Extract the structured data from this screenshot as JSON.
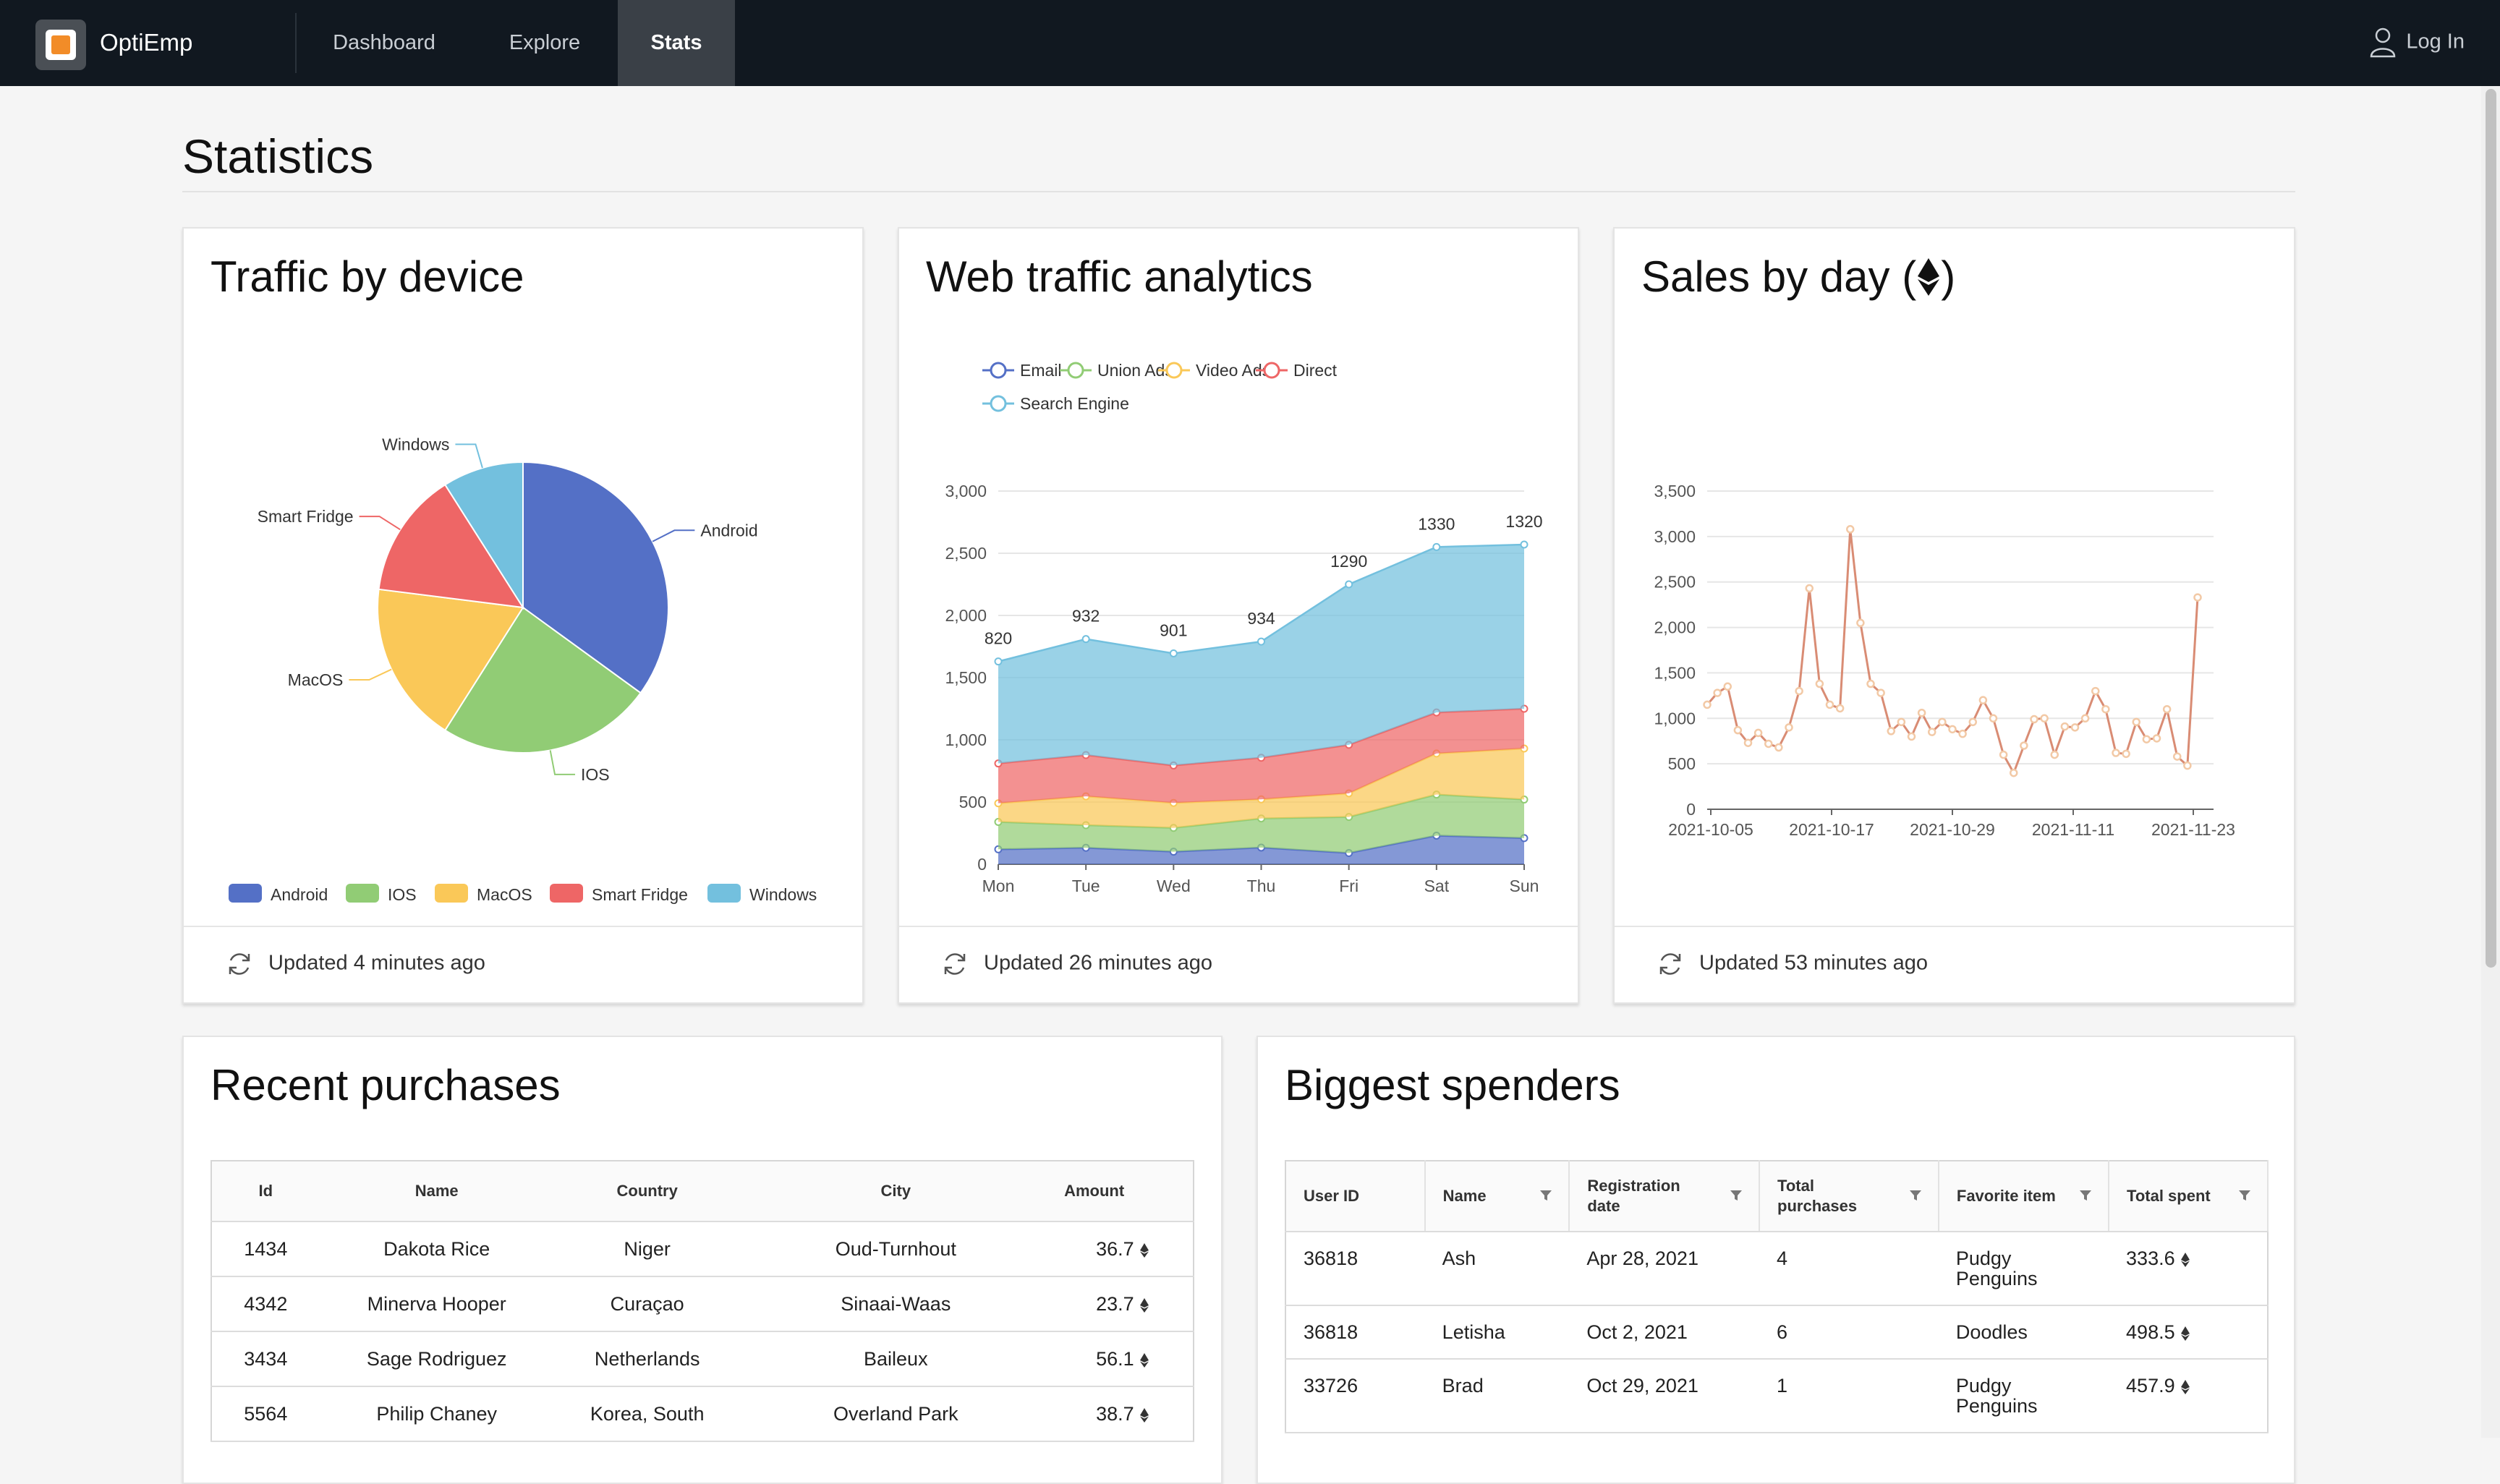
{
  "app": {
    "brand": "OptiEmp",
    "login": "Log In"
  },
  "nav": [
    {
      "label": "Dashboard",
      "active": false
    },
    {
      "label": "Explore",
      "active": false
    },
    {
      "label": "Stats",
      "active": true
    }
  ],
  "page": {
    "title": "Statistics"
  },
  "cards": {
    "traffic_device": {
      "title": "Traffic by device",
      "updated": "Updated 4 minutes ago"
    },
    "web_traffic": {
      "title": "Web traffic analytics",
      "updated": "Updated 26 minutes ago"
    },
    "sales_day": {
      "title": "Sales by day (",
      "title_end": ")",
      "updated": "Updated 53 minutes ago"
    }
  },
  "chart_data": [
    {
      "type": "pie",
      "title": "Traffic by device",
      "labels": [
        "Android",
        "IOS",
        "MacOS",
        "Smart Fridge",
        "Windows"
      ],
      "values": [
        35,
        24,
        18,
        14,
        9
      ],
      "colors": [
        "#5470c6",
        "#91cc75",
        "#fac858",
        "#ee6666",
        "#73c0de"
      ],
      "legend_position": "bottom"
    },
    {
      "type": "area",
      "stacked": true,
      "title": "Web traffic analytics",
      "categories": [
        "Mon",
        "Tue",
        "Wed",
        "Thu",
        "Fri",
        "Sat",
        "Sun"
      ],
      "ylim": [
        0,
        3000
      ],
      "yticks": [
        0,
        500,
        1000,
        1500,
        2000,
        2500,
        3000
      ],
      "series": [
        {
          "name": "Email",
          "color": "#5470c6",
          "values": [
            120,
            132,
            101,
            134,
            90,
            230,
            210
          ]
        },
        {
          "name": "Union Ads",
          "color": "#91cc75",
          "values": [
            220,
            182,
            191,
            234,
            290,
            330,
            310
          ]
        },
        {
          "name": "Video Ads",
          "color": "#fac858",
          "values": [
            150,
            232,
            201,
            154,
            190,
            330,
            410
          ]
        },
        {
          "name": "Direct",
          "color": "#ee6666",
          "values": [
            320,
            332,
            301,
            334,
            390,
            330,
            320
          ]
        },
        {
          "name": "Search Engine",
          "color": "#73c0de",
          "values": [
            820,
            932,
            901,
            934,
            1290,
            1330,
            1320
          ]
        }
      ],
      "top_labels": [
        "820",
        "932",
        "901",
        "934",
        "1290",
        "1330",
        "1320"
      ],
      "legend_position": "top"
    },
    {
      "type": "line",
      "title": "Sales by day",
      "x_tick_labels": [
        "2021-10-05",
        "2021-10-17",
        "2021-10-29",
        "2021-11-11",
        "2021-11-23"
      ],
      "ylim": [
        0,
        3500
      ],
      "yticks": [
        0,
        500,
        1000,
        1500,
        2000,
        2500,
        3000,
        3500
      ],
      "values": [
        1150,
        1280,
        1350,
        870,
        730,
        840,
        720,
        680,
        900,
        1300,
        2430,
        1380,
        1150,
        1110,
        3080,
        2050,
        1380,
        1280,
        860,
        960,
        800,
        1060,
        850,
        960,
        880,
        830,
        960,
        1200,
        1000,
        600,
        400,
        700,
        990,
        1000,
        600,
        910,
        900,
        1000,
        1300,
        1100,
        620,
        610,
        960,
        770,
        780,
        1100,
        580,
        480,
        2330
      ],
      "line_color": "#d98c74",
      "point_color": "#f2c9a6"
    }
  ],
  "recent_purchases": {
    "title": "Recent purchases",
    "columns": [
      "Id",
      "Name",
      "Country",
      "City",
      "Amount"
    ],
    "rows": [
      {
        "id": "1434",
        "name": "Dakota Rice",
        "country": "Niger",
        "city": "Oud-Turnhout",
        "amount": "36.7"
      },
      {
        "id": "4342",
        "name": "Minerva Hooper",
        "country": "Curaçao",
        "city": "Sinaai-Waas",
        "amount": "23.7"
      },
      {
        "id": "3434",
        "name": "Sage Rodriguez",
        "country": "Netherlands",
        "city": "Baileux",
        "amount": "56.1"
      },
      {
        "id": "5564",
        "name": "Philip Chaney",
        "country": "Korea, South",
        "city": "Overland Park",
        "amount": "38.7"
      }
    ]
  },
  "biggest_spenders": {
    "title": "Biggest spenders",
    "columns": [
      {
        "l1": "User ID",
        "l2": "",
        "filter": false
      },
      {
        "l1": "Name",
        "l2": "",
        "filter": true
      },
      {
        "l1": "Registration",
        "l2": "date",
        "filter": true
      },
      {
        "l1": "Total",
        "l2": "purchases",
        "filter": true
      },
      {
        "l1": "Favorite item",
        "l2": "",
        "filter": true
      },
      {
        "l1": "Total spent",
        "l2": "",
        "filter": true
      }
    ],
    "rows": [
      {
        "user_id": "36818",
        "name": "Ash",
        "reg": "Apr 28, 2021",
        "total": "4",
        "fav1": "Pudgy",
        "fav2": "Penguins",
        "spent": "333.6"
      },
      {
        "user_id": "36818",
        "name": "Letisha",
        "reg": "Oct 2, 2021",
        "total": "6",
        "fav1": "Doodles",
        "fav2": "",
        "spent": "498.5"
      },
      {
        "user_id": "33726",
        "name": "Brad",
        "reg": "Oct 29, 2021",
        "total": "1",
        "fav1": "Pudgy",
        "fav2": "Penguins",
        "spent": "457.9"
      }
    ]
  }
}
